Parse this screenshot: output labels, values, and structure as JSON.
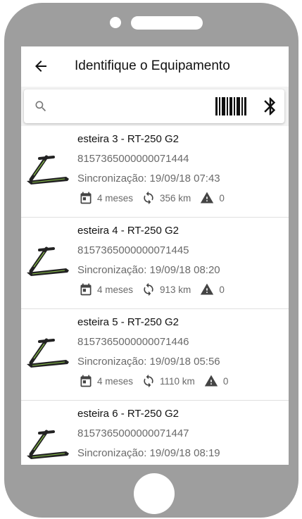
{
  "header": {
    "title": "Identifique o Equipamento"
  },
  "search": {
    "placeholder": ""
  },
  "items": [
    {
      "name": "esteira 3 - RT-250 G2",
      "serial": "8157365000000071444",
      "sync": "Sincronização: 19/09/18 07:43",
      "months": "4 meses",
      "distance": "356 km",
      "alerts": "0"
    },
    {
      "name": "esteira 4 - RT-250 G2",
      "serial": "8157365000000071445",
      "sync": "Sincronização: 19/09/18 08:20",
      "months": "4 meses",
      "distance": "913 km",
      "alerts": "0"
    },
    {
      "name": "esteira 5 - RT-250 G2",
      "serial": "8157365000000071446",
      "sync": "Sincronização: 19/09/18 05:56",
      "months": "4 meses",
      "distance": "1110 km",
      "alerts": "0"
    },
    {
      "name": "esteira 6 - RT-250 G2",
      "serial": "8157365000000071447",
      "sync": "Sincronização: 19/09/18 08:19"
    }
  ],
  "colors": {
    "phone_body": "#9e9e9e",
    "screen_bg": "#f3f3f3",
    "text_primary": "#111111",
    "text_secondary": "#6a6a6a",
    "treadmill_accent": "#8bc34a"
  },
  "icons": {
    "back": "arrow-left-icon",
    "search": "search-icon",
    "barcode": "barcode-icon",
    "bluetooth": "bluetooth-icon",
    "calendar": "calendar-icon",
    "sync": "sync-icon",
    "warning": "warning-icon",
    "treadmill": "treadmill-icon"
  }
}
